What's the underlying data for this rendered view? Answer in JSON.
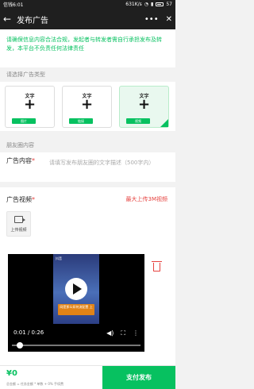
{
  "status": {
    "time": "信钱6:01",
    "speed": "631K/s",
    "battery": "57"
  },
  "header": {
    "back_icon": "back-arrow-icon",
    "title": "发布广告",
    "more_icon": "more-dots-icon",
    "close_icon": "close-icon"
  },
  "notice": {
    "text": "请确保信息内容合法合规，发起者与转发者需自行承担发布及转发，本平台不负责任何法律责任"
  },
  "section_type_label": "请选择广告类型",
  "types": [
    {
      "title": "文字",
      "badge": "图片",
      "selected": false
    },
    {
      "title": "文字",
      "badge": "链接",
      "selected": false
    },
    {
      "title": "文字",
      "badge": "视频",
      "selected": true
    }
  ],
  "section_content_label": "朋友圈内容",
  "content": {
    "label": "广告内容",
    "required_mark": "*",
    "placeholder": "请填写发布朋友圈的文字描述（500字内）"
  },
  "video": {
    "label": "广告视频",
    "required_mark": "*",
    "max_hint": "最大上传3M视频",
    "upload_label": "上传视频",
    "tiktok_label": "抖音",
    "caption": "网是那么如何流配置 上",
    "player": {
      "time": "0:01 / 0:26",
      "progress": 0.04
    }
  },
  "bottom": {
    "price": "¥0",
    "note": "总金额 = 任务金额 * 单数 + 0% 手续费",
    "submit_label": "支付发布"
  }
}
